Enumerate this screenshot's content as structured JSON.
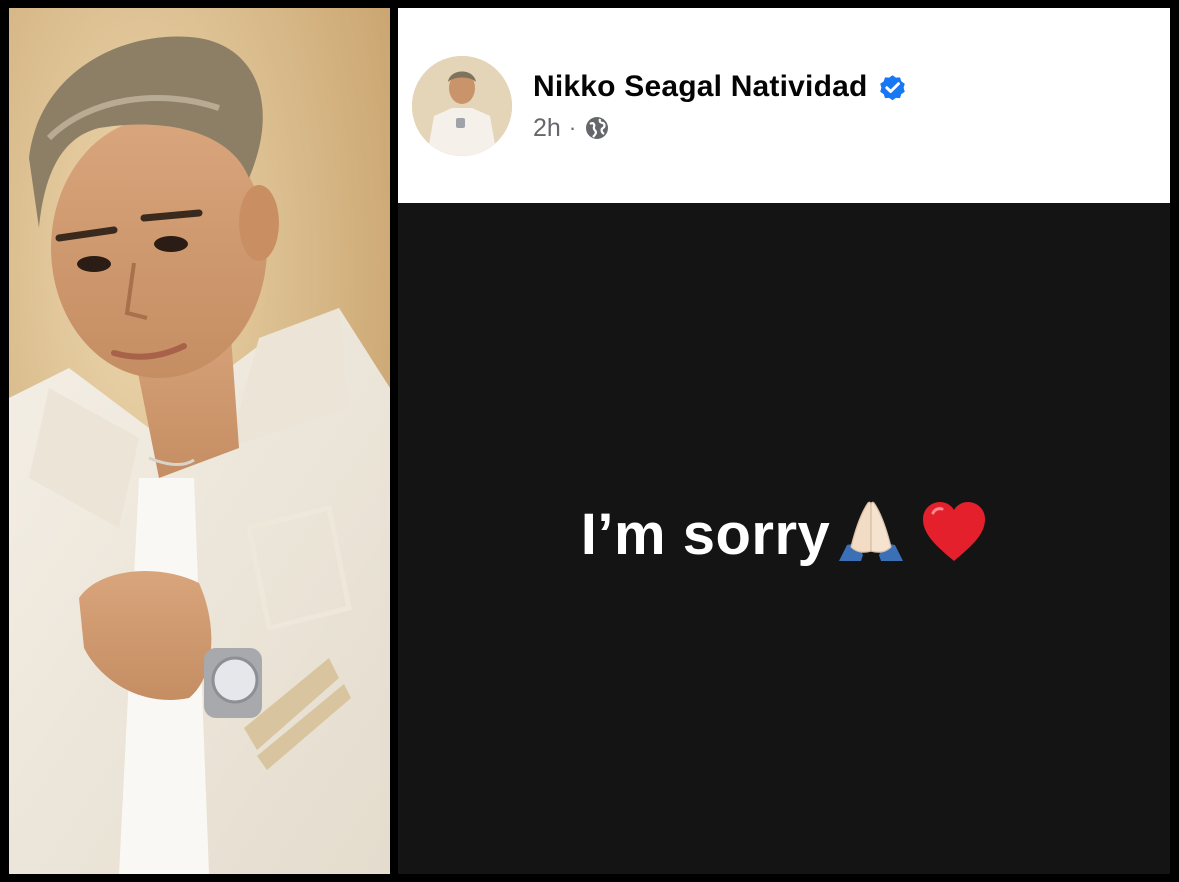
{
  "post": {
    "author_name": "Nikko Seagal Natividad",
    "time_ago": "2h",
    "separator": "·",
    "audience_icon": "globe-icon",
    "verified_icon": "verified-badge-icon",
    "text": "I’m sorry",
    "emojis": [
      "folded-hands-icon",
      "red-heart-icon"
    ]
  },
  "colors": {
    "verified_blue": "#1877f2",
    "post_background": "#141414",
    "header_background": "#ffffff",
    "meta_grey": "#65676b"
  }
}
